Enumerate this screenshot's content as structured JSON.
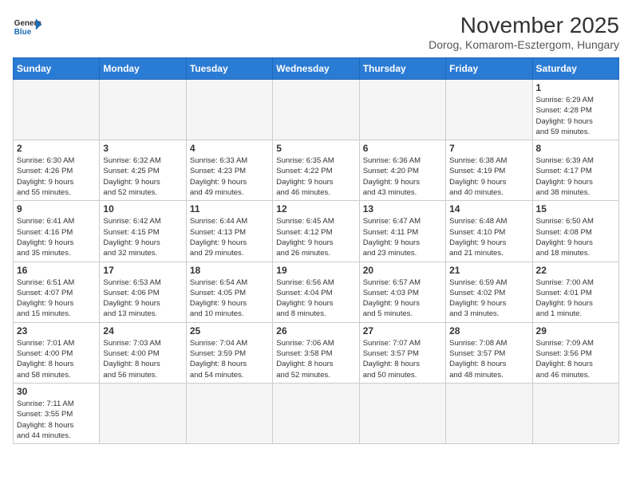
{
  "header": {
    "logo_general": "General",
    "logo_blue": "Blue",
    "month_title": "November 2025",
    "location": "Dorog, Komarom-Esztergom, Hungary"
  },
  "weekdays": [
    "Sunday",
    "Monday",
    "Tuesday",
    "Wednesday",
    "Thursday",
    "Friday",
    "Saturday"
  ],
  "weeks": [
    [
      {
        "day": "",
        "info": ""
      },
      {
        "day": "",
        "info": ""
      },
      {
        "day": "",
        "info": ""
      },
      {
        "day": "",
        "info": ""
      },
      {
        "day": "",
        "info": ""
      },
      {
        "day": "",
        "info": ""
      },
      {
        "day": "1",
        "info": "Sunrise: 6:29 AM\nSunset: 4:28 PM\nDaylight: 9 hours\nand 59 minutes."
      }
    ],
    [
      {
        "day": "2",
        "info": "Sunrise: 6:30 AM\nSunset: 4:26 PM\nDaylight: 9 hours\nand 55 minutes."
      },
      {
        "day": "3",
        "info": "Sunrise: 6:32 AM\nSunset: 4:25 PM\nDaylight: 9 hours\nand 52 minutes."
      },
      {
        "day": "4",
        "info": "Sunrise: 6:33 AM\nSunset: 4:23 PM\nDaylight: 9 hours\nand 49 minutes."
      },
      {
        "day": "5",
        "info": "Sunrise: 6:35 AM\nSunset: 4:22 PM\nDaylight: 9 hours\nand 46 minutes."
      },
      {
        "day": "6",
        "info": "Sunrise: 6:36 AM\nSunset: 4:20 PM\nDaylight: 9 hours\nand 43 minutes."
      },
      {
        "day": "7",
        "info": "Sunrise: 6:38 AM\nSunset: 4:19 PM\nDaylight: 9 hours\nand 40 minutes."
      },
      {
        "day": "8",
        "info": "Sunrise: 6:39 AM\nSunset: 4:17 PM\nDaylight: 9 hours\nand 38 minutes."
      }
    ],
    [
      {
        "day": "9",
        "info": "Sunrise: 6:41 AM\nSunset: 4:16 PM\nDaylight: 9 hours\nand 35 minutes."
      },
      {
        "day": "10",
        "info": "Sunrise: 6:42 AM\nSunset: 4:15 PM\nDaylight: 9 hours\nand 32 minutes."
      },
      {
        "day": "11",
        "info": "Sunrise: 6:44 AM\nSunset: 4:13 PM\nDaylight: 9 hours\nand 29 minutes."
      },
      {
        "day": "12",
        "info": "Sunrise: 6:45 AM\nSunset: 4:12 PM\nDaylight: 9 hours\nand 26 minutes."
      },
      {
        "day": "13",
        "info": "Sunrise: 6:47 AM\nSunset: 4:11 PM\nDaylight: 9 hours\nand 23 minutes."
      },
      {
        "day": "14",
        "info": "Sunrise: 6:48 AM\nSunset: 4:10 PM\nDaylight: 9 hours\nand 21 minutes."
      },
      {
        "day": "15",
        "info": "Sunrise: 6:50 AM\nSunset: 4:08 PM\nDaylight: 9 hours\nand 18 minutes."
      }
    ],
    [
      {
        "day": "16",
        "info": "Sunrise: 6:51 AM\nSunset: 4:07 PM\nDaylight: 9 hours\nand 15 minutes."
      },
      {
        "day": "17",
        "info": "Sunrise: 6:53 AM\nSunset: 4:06 PM\nDaylight: 9 hours\nand 13 minutes."
      },
      {
        "day": "18",
        "info": "Sunrise: 6:54 AM\nSunset: 4:05 PM\nDaylight: 9 hours\nand 10 minutes."
      },
      {
        "day": "19",
        "info": "Sunrise: 6:56 AM\nSunset: 4:04 PM\nDaylight: 9 hours\nand 8 minutes."
      },
      {
        "day": "20",
        "info": "Sunrise: 6:57 AM\nSunset: 4:03 PM\nDaylight: 9 hours\nand 5 minutes."
      },
      {
        "day": "21",
        "info": "Sunrise: 6:59 AM\nSunset: 4:02 PM\nDaylight: 9 hours\nand 3 minutes."
      },
      {
        "day": "22",
        "info": "Sunrise: 7:00 AM\nSunset: 4:01 PM\nDaylight: 9 hours\nand 1 minute."
      }
    ],
    [
      {
        "day": "23",
        "info": "Sunrise: 7:01 AM\nSunset: 4:00 PM\nDaylight: 8 hours\nand 58 minutes."
      },
      {
        "day": "24",
        "info": "Sunrise: 7:03 AM\nSunset: 4:00 PM\nDaylight: 8 hours\nand 56 minutes."
      },
      {
        "day": "25",
        "info": "Sunrise: 7:04 AM\nSunset: 3:59 PM\nDaylight: 8 hours\nand 54 minutes."
      },
      {
        "day": "26",
        "info": "Sunrise: 7:06 AM\nSunset: 3:58 PM\nDaylight: 8 hours\nand 52 minutes."
      },
      {
        "day": "27",
        "info": "Sunrise: 7:07 AM\nSunset: 3:57 PM\nDaylight: 8 hours\nand 50 minutes."
      },
      {
        "day": "28",
        "info": "Sunrise: 7:08 AM\nSunset: 3:57 PM\nDaylight: 8 hours\nand 48 minutes."
      },
      {
        "day": "29",
        "info": "Sunrise: 7:09 AM\nSunset: 3:56 PM\nDaylight: 8 hours\nand 46 minutes."
      }
    ],
    [
      {
        "day": "30",
        "info": "Sunrise: 7:11 AM\nSunset: 3:55 PM\nDaylight: 8 hours\nand 44 minutes."
      },
      {
        "day": "",
        "info": ""
      },
      {
        "day": "",
        "info": ""
      },
      {
        "day": "",
        "info": ""
      },
      {
        "day": "",
        "info": ""
      },
      {
        "day": "",
        "info": ""
      },
      {
        "day": "",
        "info": ""
      }
    ]
  ]
}
